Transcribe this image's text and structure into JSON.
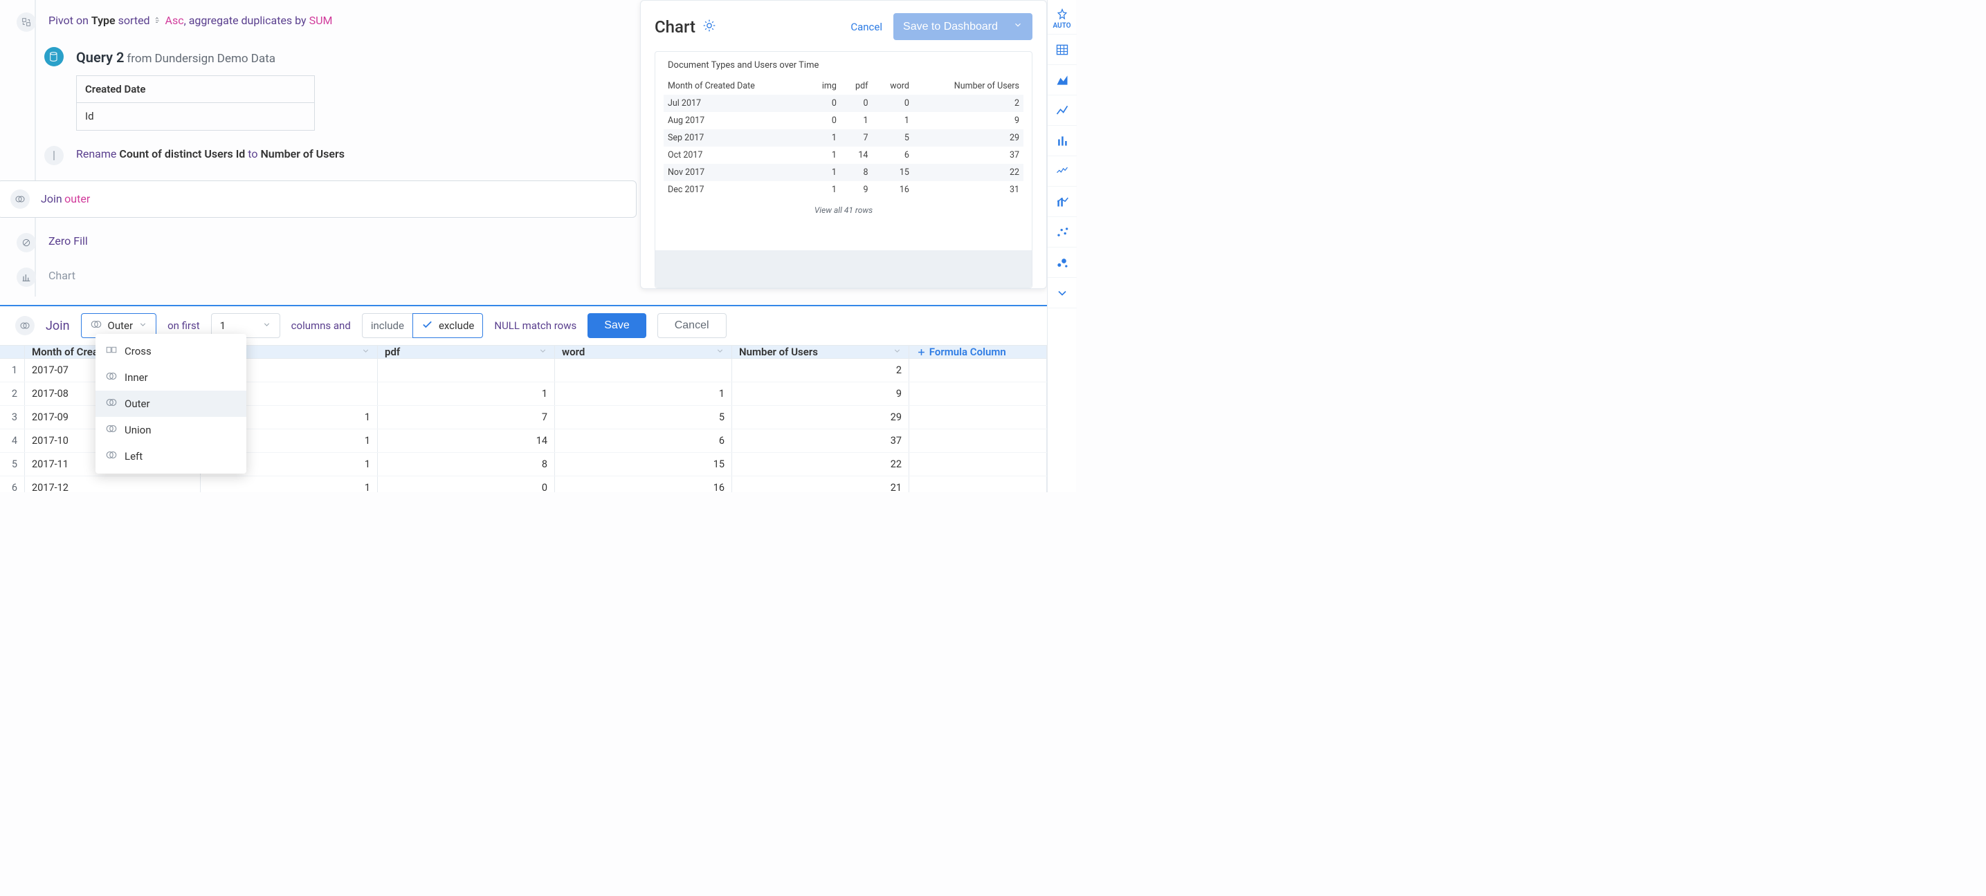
{
  "pipeline": {
    "pivot": {
      "prefix": "Pivot on",
      "field": "Type",
      "sorted": "sorted",
      "dir": "Asc",
      "agg_prefix": ", aggregate duplicates by",
      "agg": "SUM"
    },
    "query": {
      "title": "Query 2",
      "from": "from",
      "source": "Dundersign Demo Data",
      "columns_header": "Created Date",
      "columns_row": "Id"
    },
    "rename": {
      "verb": "Rename",
      "from": "Count of distinct Users Id",
      "to_word": "to",
      "to": "Number of Users"
    },
    "join": {
      "verb": "Join",
      "type": "outer"
    },
    "zero": {
      "label": "Zero Fill"
    },
    "chart": {
      "label": "Chart"
    }
  },
  "chart_panel": {
    "title": "Chart",
    "cancel": "Cancel",
    "save": "Save to Dashboard",
    "subtitle": "Document Types and Users over Time",
    "view_all": "View all 41 rows"
  },
  "chart_data": {
    "type": "table",
    "columns": [
      "Month of Created Date",
      "img",
      "pdf",
      "word",
      "Number of Users"
    ],
    "rows": [
      {
        "c0": "Jul 2017",
        "c1": "0",
        "c2": "0",
        "c3": "0",
        "c4": "2"
      },
      {
        "c0": "Aug 2017",
        "c1": "0",
        "c2": "1",
        "c3": "1",
        "c4": "9"
      },
      {
        "c0": "Sep 2017",
        "c1": "1",
        "c2": "7",
        "c3": "5",
        "c4": "29"
      },
      {
        "c0": "Oct 2017",
        "c1": "1",
        "c2": "14",
        "c3": "6",
        "c4": "37"
      },
      {
        "c0": "Nov 2017",
        "c1": "1",
        "c2": "8",
        "c3": "15",
        "c4": "22"
      },
      {
        "c0": "Dec 2017",
        "c1": "1",
        "c2": "9",
        "c3": "16",
        "c4": "31"
      }
    ]
  },
  "toolbar": {
    "join_label": "Join",
    "join_type": "Outer",
    "on_first": "on first",
    "n": "1",
    "columns_and": "columns and",
    "include": "include",
    "exclude": "exclude",
    "null_match": "NULL match rows",
    "save": "Save",
    "cancel": "Cancel"
  },
  "dropdown": {
    "items": [
      {
        "id": "cross",
        "label": "Cross"
      },
      {
        "id": "inner",
        "label": "Inner"
      },
      {
        "id": "outer",
        "label": "Outer"
      },
      {
        "id": "union",
        "label": "Union"
      },
      {
        "id": "left",
        "label": "Left"
      }
    ]
  },
  "grid": {
    "columns": [
      "Month of Created Date",
      "img",
      "pdf",
      "word",
      "Number of Users"
    ],
    "formula_col": "Formula Column",
    "rows": [
      {
        "idx": "1",
        "c0": "2017-07",
        "c1": "",
        "c2": "",
        "c3": "",
        "c4": "2"
      },
      {
        "idx": "2",
        "c0": "2017-08",
        "c1": "",
        "c2": "1",
        "c3": "1",
        "c4": "9"
      },
      {
        "idx": "3",
        "c0": "2017-09",
        "c1": "1",
        "c2": "7",
        "c3": "5",
        "c4": "29"
      },
      {
        "idx": "4",
        "c0": "2017-10",
        "c1": "1",
        "c2": "14",
        "c3": "6",
        "c4": "37"
      },
      {
        "idx": "5",
        "c0": "2017-11",
        "c1": "1",
        "c2": "8",
        "c3": "15",
        "c4": "22"
      },
      {
        "idx": "6",
        "c0": "2017-12",
        "c1": "1",
        "c2": "0",
        "c3": "16",
        "c4": "21"
      }
    ]
  },
  "rail": {
    "auto": "AUTO"
  }
}
